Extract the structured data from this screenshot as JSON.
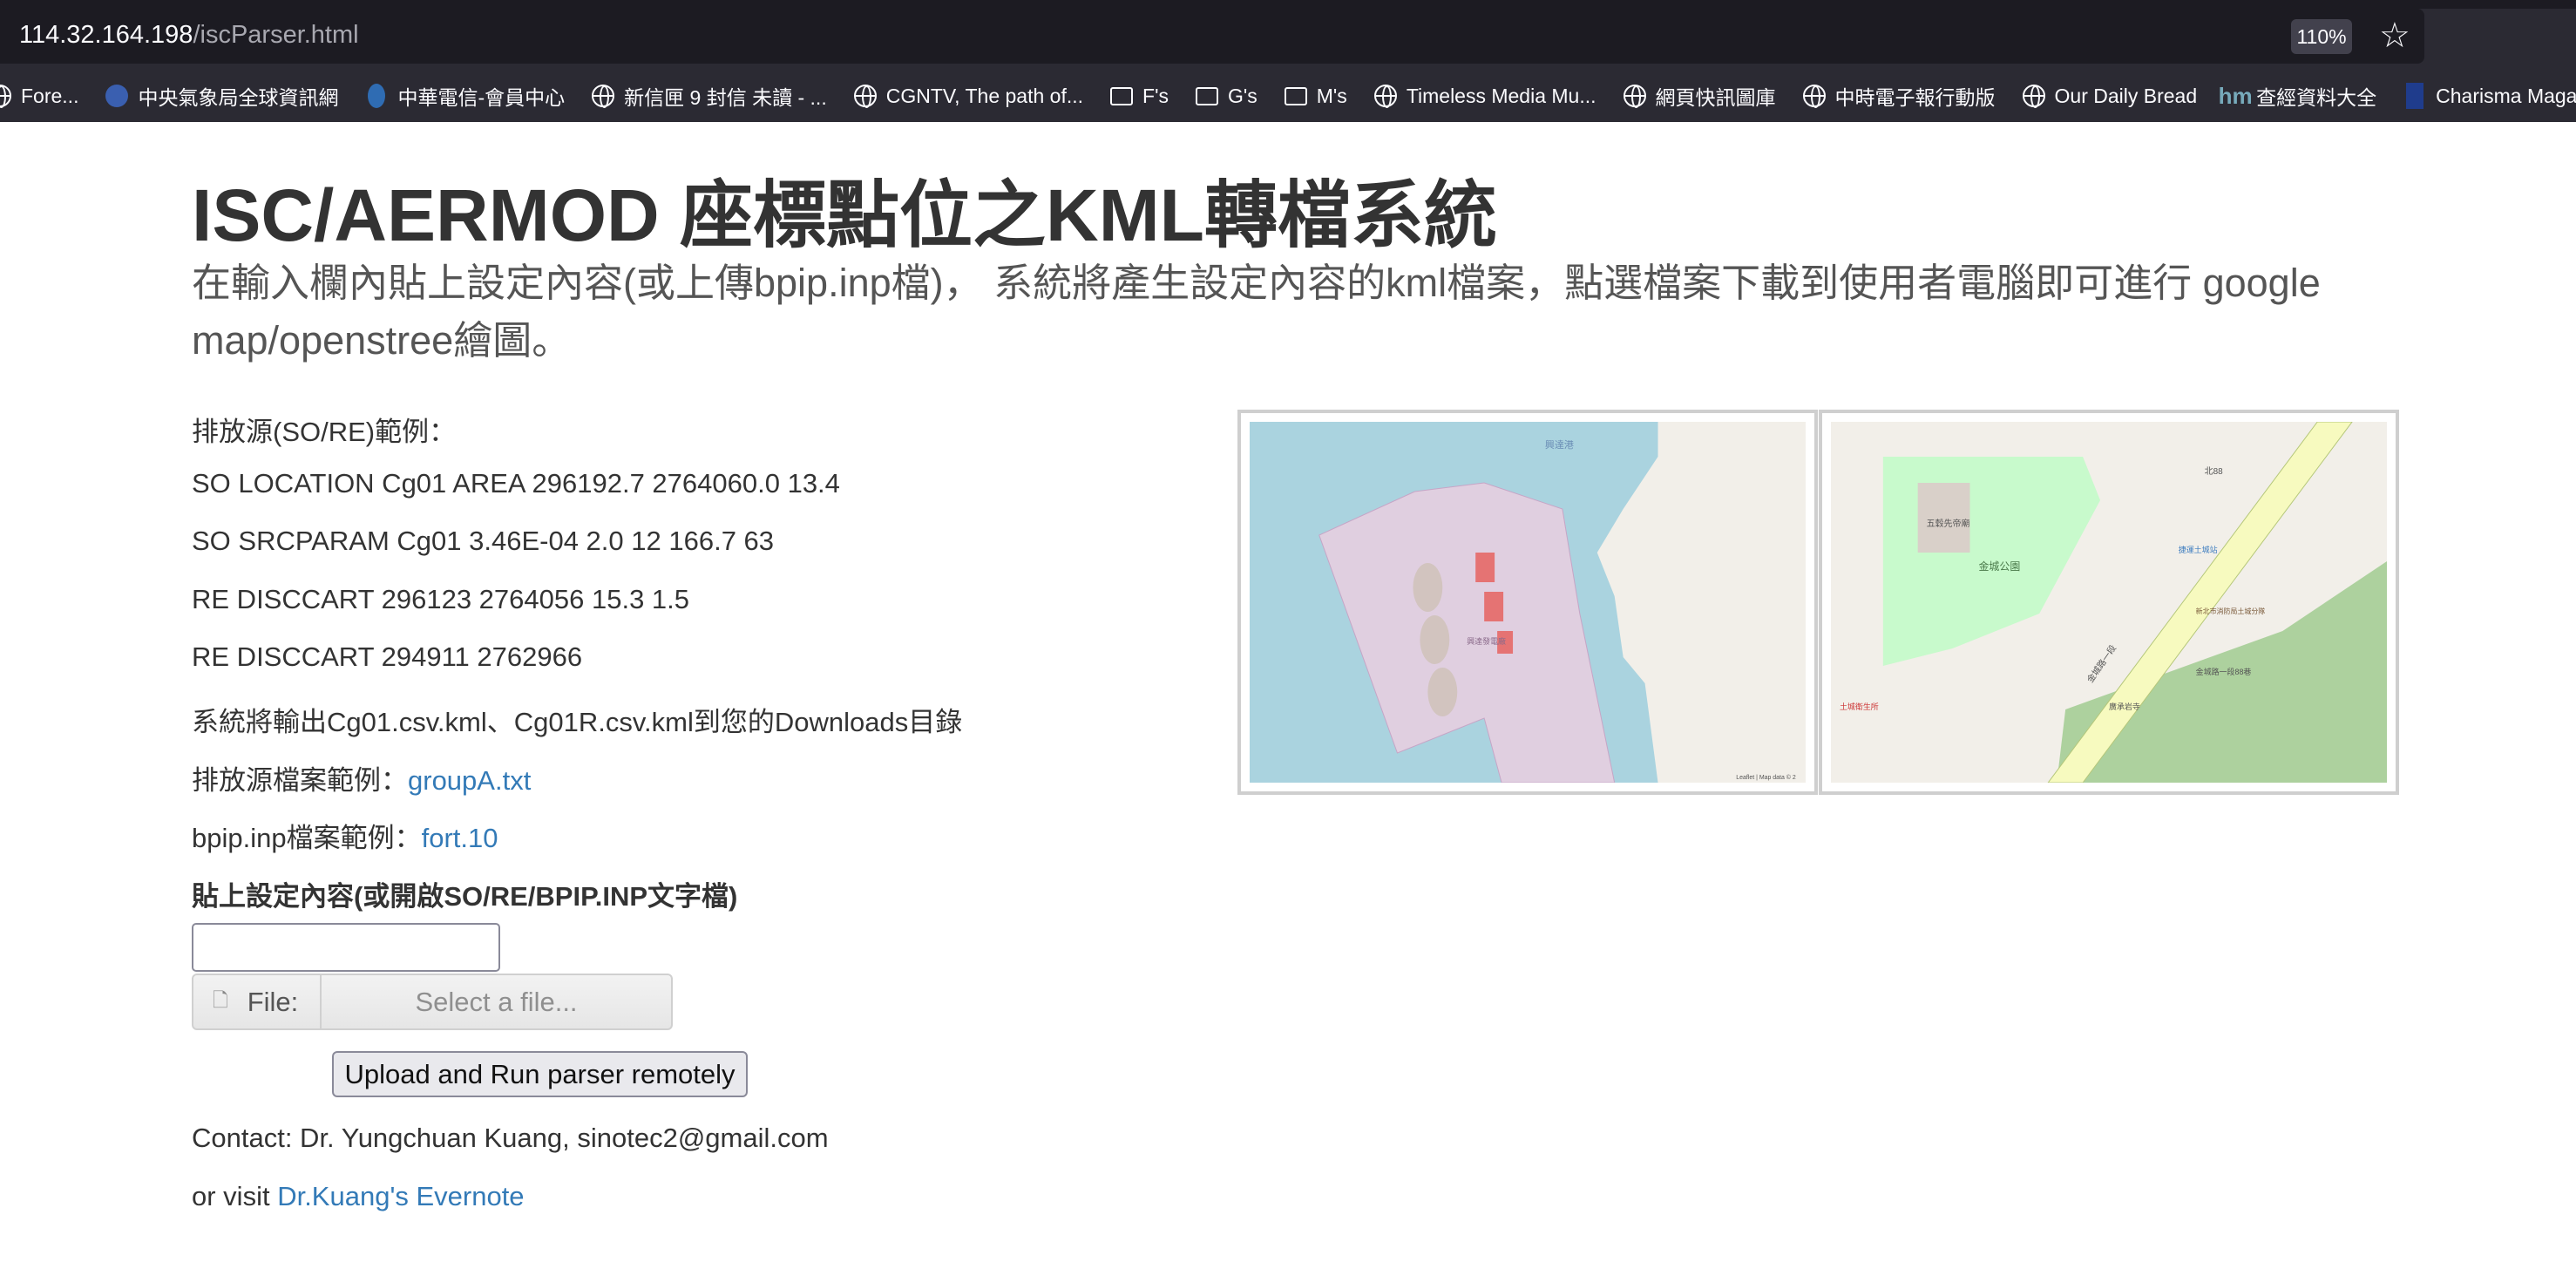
{
  "browser": {
    "url_host": "114.32.164.198",
    "url_path": "/iscParser.html",
    "zoom": "110%",
    "bookmarks": [
      {
        "label": "Fore...",
        "icon": "globe-icon"
      },
      {
        "label": "中央氣象局全球資訊網",
        "icon": "cwb-icon"
      },
      {
        "label": "中華電信-會員中心",
        "icon": "cht-icon"
      },
      {
        "label": "新信匣 9 封信 未讀 - ...",
        "icon": "globe-icon"
      },
      {
        "label": "CGNTV, The path of...",
        "icon": "globe-icon"
      },
      {
        "label": "F's",
        "icon": "folder-icon"
      },
      {
        "label": "G's",
        "icon": "folder-icon"
      },
      {
        "label": "M's",
        "icon": "folder-icon"
      },
      {
        "label": "Timeless Media Mu...",
        "icon": "globe-icon"
      },
      {
        "label": "網頁快訊圖庫",
        "icon": "globe-icon"
      },
      {
        "label": "中時電子報行動版",
        "icon": "globe-icon"
      },
      {
        "label": "Our Daily Bread",
        "icon": "globe-icon"
      },
      {
        "label": "查經資料大全",
        "icon": "hm-icon"
      },
      {
        "label": "Charisma Magazine ...",
        "icon": "charisma-icon"
      }
    ]
  },
  "page": {
    "title": "ISC/AERMOD 座標點位之KML轉檔系統",
    "subtitle": "在輸入欄內貼上設定內容(或上傳bpip.inp檔)， 系統將產生設定內容的kml檔案，點選檔案下載到使用者電腦即可進行 google map/openstree繪圖。",
    "example_heading": "排放源(SO/RE)範例：",
    "examples": [
      "SO LOCATION Cg01 AREA 296192.7 2764060.0 13.4",
      "SO SRCPARAM Cg01 3.46E-04 2.0 12 166.7 63",
      "RE DISCCART 296123 2764056 15.3 1.5",
      "RE DISCCART 294911 2762966"
    ],
    "output_note": "系統將輸出Cg01.csv.kml、Cg01R.csv.kml到您的Downloads目錄",
    "source_file_label": "排放源檔案範例：",
    "source_file_link": "groupA.txt",
    "bpip_label": "bpip.inp檔案範例：",
    "bpip_link": "fort.10",
    "paste_label": "貼上設定內容(或開啟SO/RE/BPIP.INP文字檔)",
    "paste_value": "",
    "file_label": "File:",
    "file_placeholder": "Select a file...",
    "run_button": "Upload and Run parser remotely",
    "contact": "Contact: Dr. Yungchuan Kuang, sinotec2@gmail.com",
    "visit_prefix": "or visit ",
    "visit_link": "Dr.Kuang's Evernote",
    "map1_attribution": "Leaflet | Map data © 2",
    "map1_labels": [
      "興達港",
      "興達發電廠"
    ],
    "map2_labels": [
      "金城公園",
      "五穀先帝廟",
      "北88",
      "捷運土城站",
      "新北市消防局土城分隊",
      "廣承岩寺",
      "土城衛生所",
      "金城路一段",
      "金城路一段88巷"
    ]
  },
  "colors": {
    "link": "#337ab7",
    "water": "#aad3df",
    "industrial": "#e0cfe0",
    "park": "#c8facc"
  }
}
